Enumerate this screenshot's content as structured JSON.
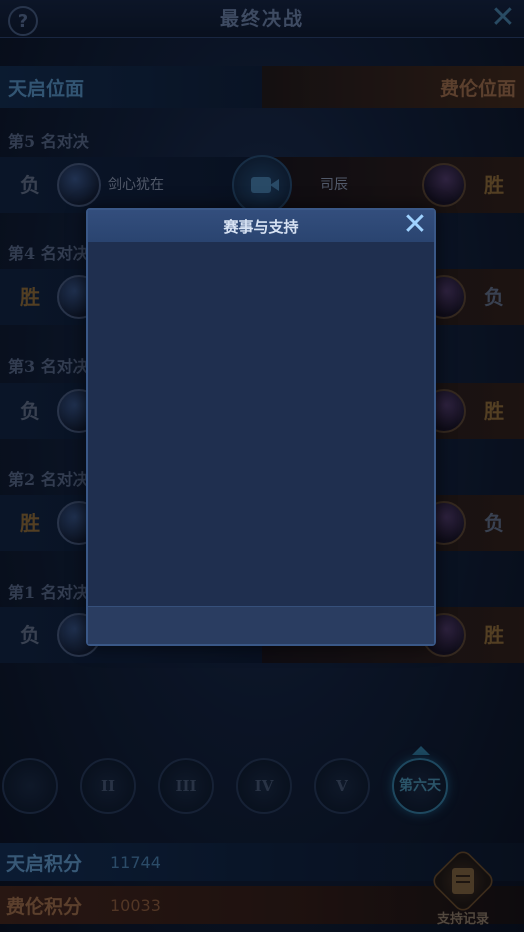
{
  "header": {
    "title": "最终决战",
    "help_icon": "?",
    "close_icon": "✕"
  },
  "factions": {
    "left": "天启位面",
    "right": "费伦位面"
  },
  "matches": [
    {
      "round": "第5 名对决",
      "left_result": "负",
      "left_name": "剑心犹在",
      "right_name": "司辰",
      "right_result": "胜"
    },
    {
      "round": "第4 名对决",
      "left_result": "胜",
      "left_name": "",
      "right_name": "",
      "right_result": "负"
    },
    {
      "round": "第3 名对决",
      "left_result": "负",
      "left_name": "",
      "right_name": "",
      "right_result": "胜"
    },
    {
      "round": "第2 名对决",
      "left_result": "胜",
      "left_name": "",
      "right_name": "",
      "right_result": "负"
    },
    {
      "round": "第1 名对决",
      "left_result": "负",
      "left_name": "",
      "right_name": "",
      "right_result": "胜"
    }
  ],
  "days": [
    "",
    "II",
    "III",
    "IV",
    "V",
    "第六天"
  ],
  "scores": {
    "tianqi_label": "天启积分",
    "tianqi_value": "11744",
    "feilun_label": "费伦积分",
    "feilun_value": "10033"
  },
  "support_record_label": "支持记录",
  "modal": {
    "title": "赛事与支持",
    "close_icon": "✕"
  },
  "colors": {
    "modal_bg": "#1f2f4f",
    "modal_header": "#2a4470",
    "modal_close": "#9fd2ff"
  }
}
